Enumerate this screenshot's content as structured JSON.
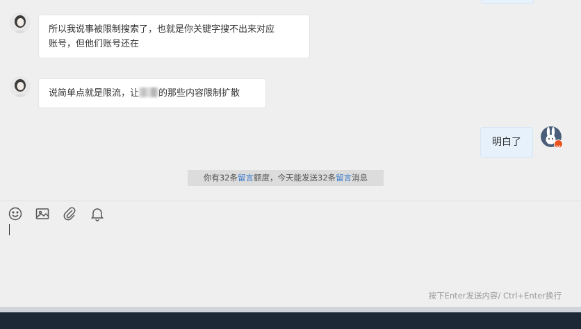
{
  "messages": [
    {
      "side": "left",
      "line1": "所以我说事被限制搜索了，也就是你关键字搜不出来对应",
      "line2": "账号，但他们账号还在"
    },
    {
      "side": "left",
      "before": "说简单点就是限流，让",
      "after": "的那些内容限制扩散"
    },
    {
      "side": "right",
      "text": "明白了"
    }
  ],
  "notice": {
    "p1": "你有32条",
    "link1": "留言",
    "p2": "额度，今天能发送32条",
    "link2": "留言",
    "p3": "消息"
  },
  "toolbar": {
    "icons": [
      "emoji-icon",
      "image-icon",
      "attachment-icon",
      "bell-icon"
    ]
  },
  "input": {
    "value": ""
  },
  "hint": "按下Enter发送内容/ Ctrl+Enter换行",
  "colors": {
    "background": "#efefef",
    "bubble_self": "#e6f1fb",
    "link": "#3a7ccb",
    "taskbar": "#1c2836"
  }
}
